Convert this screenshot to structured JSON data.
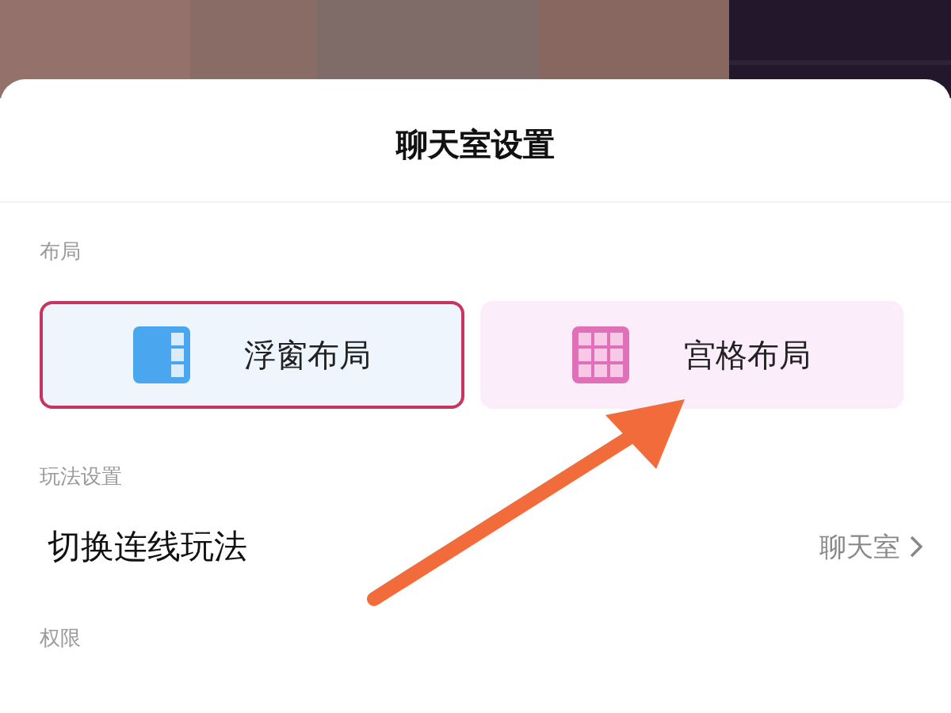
{
  "sheet": {
    "title": "聊天室设置"
  },
  "layout_section": {
    "label": "布局",
    "options": [
      {
        "kind": "float",
        "label": "浮窗布局",
        "selected": true
      },
      {
        "kind": "grid",
        "label": "宫格布局",
        "selected": false
      }
    ]
  },
  "play_section": {
    "label": "玩法设置",
    "rows": [
      {
        "label": "切换连线玩法",
        "value": "聊天室"
      }
    ]
  },
  "permission_section": {
    "label": "权限"
  }
}
